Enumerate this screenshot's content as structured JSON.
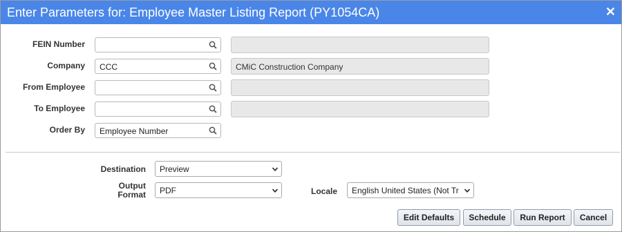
{
  "dialog": {
    "title": "Enter Parameters for: Employee Master Listing Report (PY1054CA)",
    "close_glyph": "✕"
  },
  "fields": [
    {
      "label": "FEIN Number",
      "value": "",
      "description": ""
    },
    {
      "label": "Company",
      "value": "CCC",
      "description": "CMiC Construction Company"
    },
    {
      "label": "From Employee",
      "value": "",
      "description": ""
    },
    {
      "label": "To Employee",
      "value": "",
      "description": ""
    },
    {
      "label": "Order By",
      "value": "Employee Number"
    }
  ],
  "output": {
    "destination_label": "Destination",
    "destination_value": "Preview",
    "format_label_line1": "Output",
    "format_label_line2": "Format",
    "format_value": "PDF",
    "locale_label": "Locale",
    "locale_value": "English United States (Not Tr"
  },
  "buttons": {
    "edit_defaults": "Edit Defaults",
    "schedule": "Schedule",
    "run_report": "Run Report",
    "cancel": "Cancel"
  },
  "colors": {
    "titlebar": "#4a86e8",
    "readonly_bg": "#e8e8e8"
  },
  "icons": {
    "search": "search-icon",
    "close": "close-icon",
    "dropdown": "chevron-down-icon"
  }
}
